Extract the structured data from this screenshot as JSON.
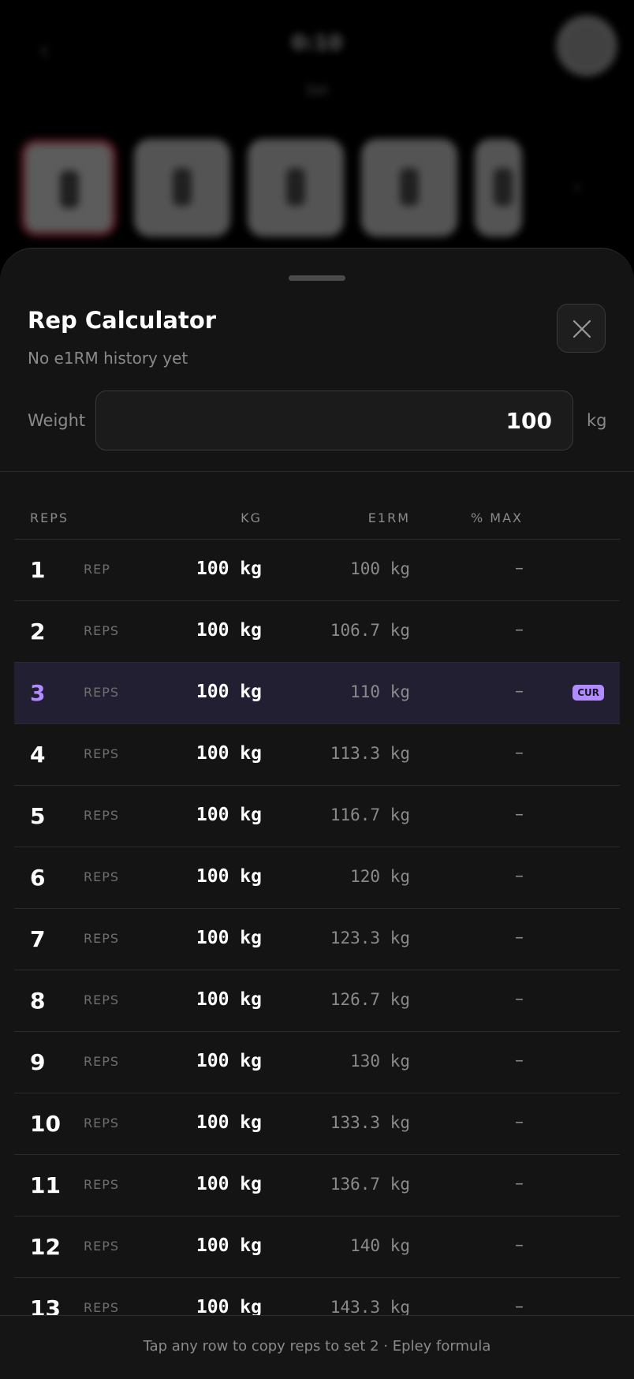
{
  "background": {
    "timer": "0:10",
    "subtitle": "Set",
    "exercise_thumbnails": [
      "exercise-1",
      "exercise-2",
      "exercise-3",
      "exercise-4",
      "exercise-5"
    ]
  },
  "sheet": {
    "title": "Rep Calculator",
    "subtitle": "No e1RM history yet",
    "close_icon": "close-icon",
    "weight_label": "Weight",
    "weight_value": "100",
    "unit": "kg"
  },
  "table": {
    "headers": {
      "reps": "REPS",
      "kg": "KG",
      "e1rm": "E1RM",
      "pct": "% MAX"
    },
    "rows": [
      {
        "reps": "1",
        "label": "REP",
        "kg": "100 kg",
        "e1rm": "100 kg",
        "pct": "–"
      },
      {
        "reps": "2",
        "label": "REPS",
        "kg": "100 kg",
        "e1rm": "106.7 kg",
        "pct": "–"
      },
      {
        "reps": "3",
        "label": "REPS",
        "kg": "100 kg",
        "e1rm": "110 kg",
        "pct": "–",
        "badge": "CUR"
      },
      {
        "reps": "4",
        "label": "REPS",
        "kg": "100 kg",
        "e1rm": "113.3 kg",
        "pct": "–"
      },
      {
        "reps": "5",
        "label": "REPS",
        "kg": "100 kg",
        "e1rm": "116.7 kg",
        "pct": "–"
      },
      {
        "reps": "6",
        "label": "REPS",
        "kg": "100 kg",
        "e1rm": "120 kg",
        "pct": "–"
      },
      {
        "reps": "7",
        "label": "REPS",
        "kg": "100 kg",
        "e1rm": "123.3 kg",
        "pct": "–"
      },
      {
        "reps": "8",
        "label": "REPS",
        "kg": "100 kg",
        "e1rm": "126.7 kg",
        "pct": "–"
      },
      {
        "reps": "9",
        "label": "REPS",
        "kg": "100 kg",
        "e1rm": "130 kg",
        "pct": "–"
      },
      {
        "reps": "10",
        "label": "REPS",
        "kg": "100 kg",
        "e1rm": "133.3 kg",
        "pct": "–"
      },
      {
        "reps": "11",
        "label": "REPS",
        "kg": "100 kg",
        "e1rm": "136.7 kg",
        "pct": "–"
      },
      {
        "reps": "12",
        "label": "REPS",
        "kg": "100 kg",
        "e1rm": "140 kg",
        "pct": "–"
      },
      {
        "reps": "13",
        "label": "REPS",
        "kg": "100 kg",
        "e1rm": "143.3 kg",
        "pct": "–"
      }
    ]
  },
  "footer": {
    "text": "Tap any row to copy reps to set 2 · Epley formula"
  },
  "colors": {
    "accent": "#b08cff",
    "sheet_bg": "#141414",
    "current_row_bg": "#231f33"
  }
}
